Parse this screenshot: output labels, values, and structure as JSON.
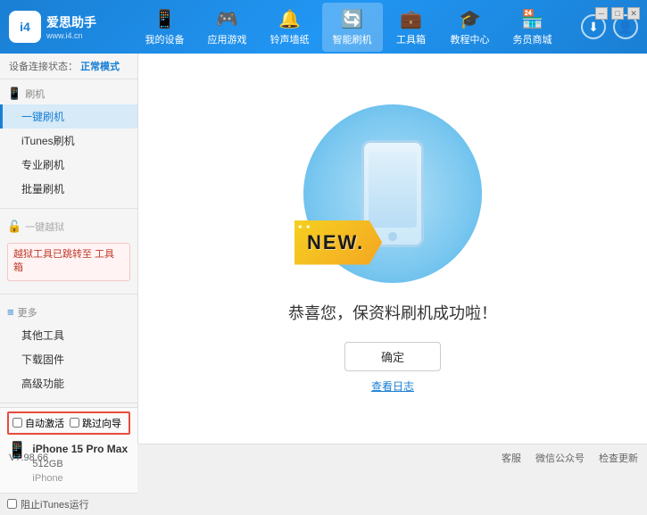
{
  "app": {
    "logo_text": "爱思助手",
    "logo_sub": "www.i4.cn",
    "logo_symbol": "i4"
  },
  "nav": {
    "items": [
      {
        "id": "my-device",
        "icon": "📱",
        "label": "我的设备"
      },
      {
        "id": "app-games",
        "icon": "👤",
        "label": "应用游戏"
      },
      {
        "id": "ringtone",
        "icon": "🔔",
        "label": "铃声墙纸"
      },
      {
        "id": "smart-flash",
        "icon": "🔄",
        "label": "智能刷机",
        "active": true
      },
      {
        "id": "tools",
        "icon": "💼",
        "label": "工具箱"
      },
      {
        "id": "tutorial",
        "icon": "🎓",
        "label": "教程中心"
      },
      {
        "id": "business",
        "icon": "📦",
        "label": "务员商城"
      }
    ],
    "download_icon": "⬇",
    "user_icon": "👤"
  },
  "sidebar": {
    "status_label": "设备连接状态：",
    "status_value": "正常模式",
    "sections": [
      {
        "id": "flash",
        "icon": "📱",
        "label": "刷机",
        "items": [
          {
            "id": "one-key-flash",
            "label": "一键刷机",
            "active": true
          },
          {
            "id": "itunes-flash",
            "label": "iTunes刷机"
          },
          {
            "id": "pro-flash",
            "label": "专业刷机"
          },
          {
            "id": "batch-flash",
            "label": "批量刷机"
          }
        ]
      },
      {
        "id": "one-key-jailbreak",
        "icon": "🔓",
        "label": "一键越狱",
        "disabled": true,
        "notice": "越狱工具已跳转至\n工具箱"
      },
      {
        "id": "more",
        "icon": "≡",
        "label": "更多",
        "items": [
          {
            "id": "other-tools",
            "label": "其他工具"
          },
          {
            "id": "download-firmware",
            "label": "下载固件"
          },
          {
            "id": "advanced",
            "label": "高级功能"
          }
        ]
      }
    ],
    "auto_activate_label": "自动激活",
    "guide_label": "跳过向导",
    "device_name": "iPhone 15 Pro Max",
    "device_storage": "512GB",
    "device_type": "iPhone",
    "stop_itunes_label": "阻止iTunes运行"
  },
  "content": {
    "new_badge": "NEW.",
    "success_message": "恭喜您，保资料刷机成功啦！",
    "confirm_button": "确定",
    "log_link": "查看日志"
  },
  "statusbar": {
    "version": "V7.98.66",
    "items": [
      "客服",
      "微信公众号",
      "检查更新"
    ]
  },
  "window_controls": [
    "▭",
    "─",
    "✕"
  ]
}
